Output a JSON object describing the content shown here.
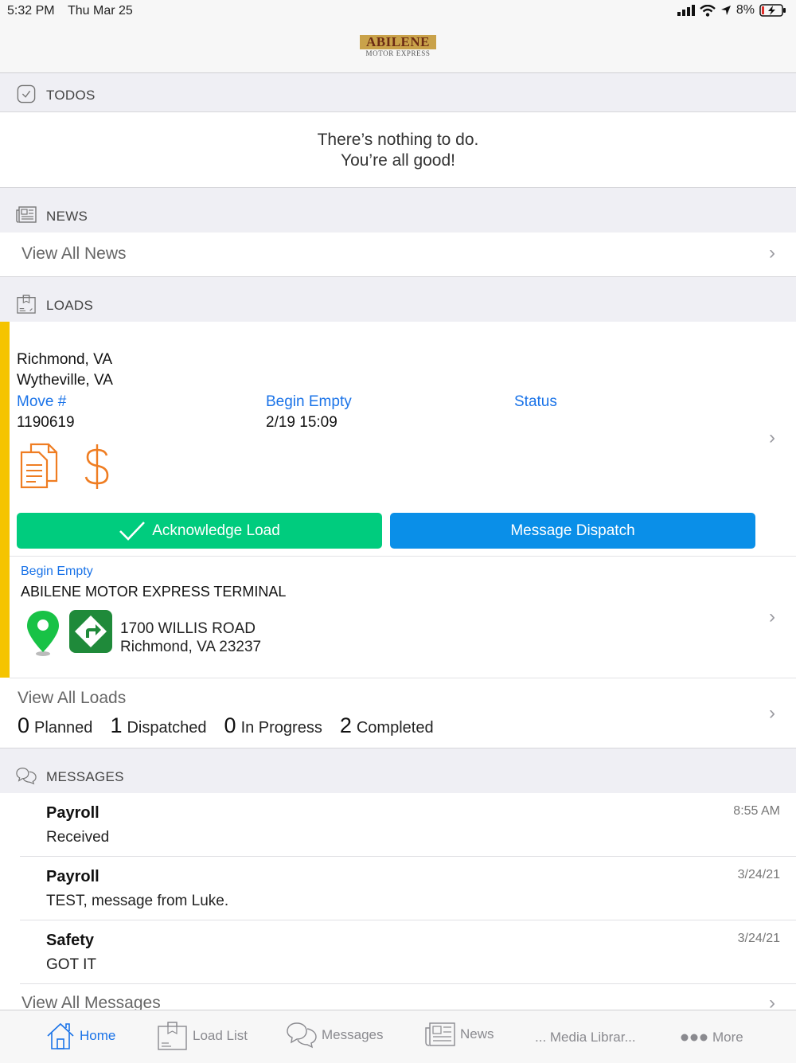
{
  "status_bar": {
    "time": "5:32 PM",
    "date": "Thu Mar 25",
    "battery": "8%"
  },
  "brand": {
    "name": "ABILENE",
    "subtitle": "MOTOR EXPRESS"
  },
  "todos": {
    "header": "TODOS",
    "line1": "There’s nothing to do.",
    "line2": "You’re all good!"
  },
  "news": {
    "header": "NEWS",
    "view_all": "View All News"
  },
  "loads": {
    "header": "LOADS",
    "origin": "Richmond, VA",
    "destination": "Wytheville, VA",
    "move_label": "Move #",
    "move_value": "1190619",
    "begin_label": "Begin Empty",
    "begin_value": "2/19 15:09",
    "status_label": "Status",
    "acknowledge_label": "Acknowledge Load",
    "message_dispatch_label": "Message Dispatch",
    "stop": {
      "type": "Begin Empty",
      "name": "ABILENE MOTOR EXPRESS TERMINAL",
      "address1": "1700 WILLIS ROAD",
      "address2": "Richmond, VA 23237"
    },
    "view_all": "View All Loads",
    "counts": [
      {
        "n": "0",
        "label": "Planned"
      },
      {
        "n": "1",
        "label": "Dispatched"
      },
      {
        "n": "0",
        "label": "In Progress"
      },
      {
        "n": "2",
        "label": "Completed"
      }
    ],
    "accent_color": "#f5c400"
  },
  "messages": {
    "header": "MESSAGES",
    "items": [
      {
        "title": "Payroll",
        "body": "Received",
        "time": "8:55 AM"
      },
      {
        "title": "Payroll",
        "body": "TEST, message from Luke.",
        "time": "3/24/21"
      },
      {
        "title": "Safety",
        "body": "GOT IT",
        "time": "3/24/21"
      }
    ],
    "view_all": "View All Messages"
  },
  "tabs": [
    {
      "label": "Home",
      "icon": "home-icon",
      "active": true
    },
    {
      "label": "Load List",
      "icon": "load-list-icon"
    },
    {
      "label": "Messages",
      "icon": "chat-bubbles-icon"
    },
    {
      "label": "News",
      "icon": "newspaper-icon"
    },
    {
      "label": "... Media Librar...",
      "icon": "media-library-icon"
    },
    {
      "label": "More",
      "icon": "more-dots-icon"
    }
  ],
  "colors": {
    "acknowledge": "#00cc7e",
    "dispatch": "#0a8fe8",
    "link_blue": "#1a73e8",
    "icon_orange": "#ef7d22"
  }
}
